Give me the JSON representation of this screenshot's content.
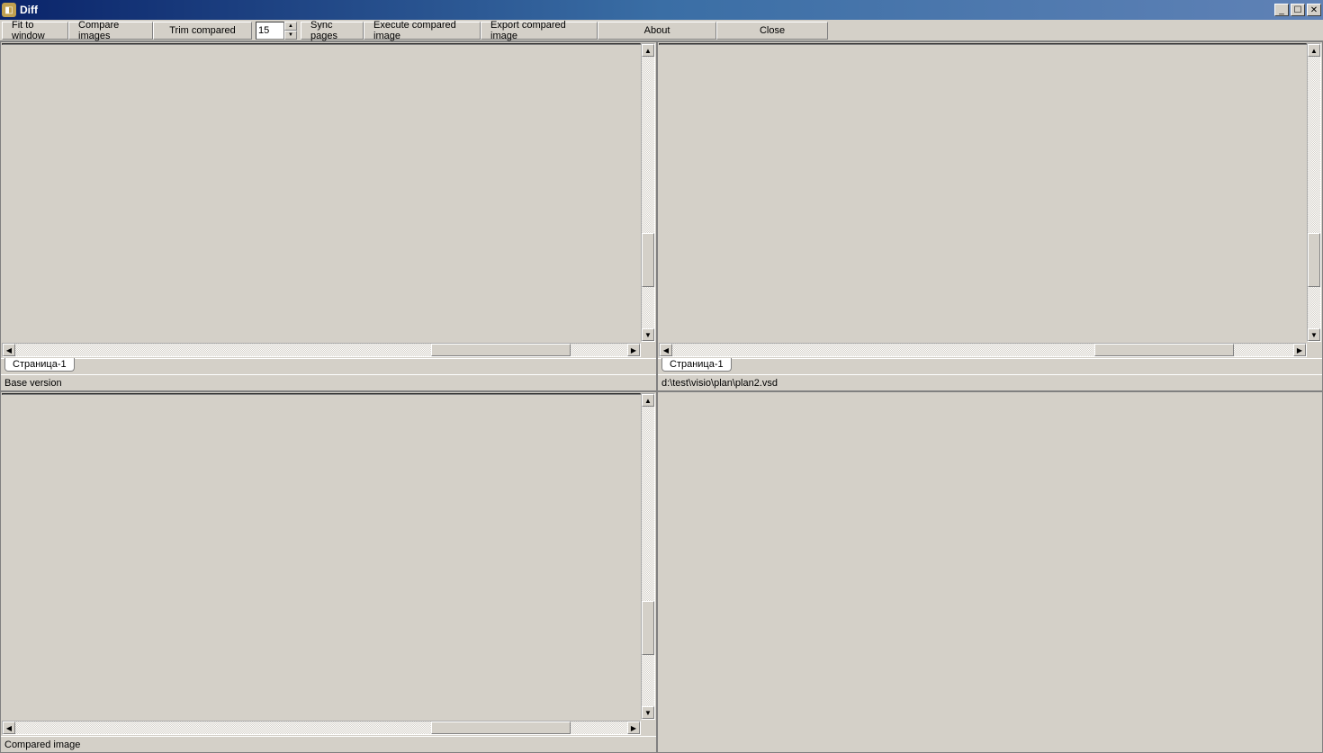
{
  "window": {
    "title": "Diff"
  },
  "toolbar": {
    "fit_label": "Fit to window",
    "compare_label": "Compare images",
    "trim_label": "Trim compared",
    "spinner_value": "15",
    "sync_label": "Sync pages",
    "execute_label": "Execute compared image",
    "export_label": "Export compared image",
    "about_label": "About",
    "close_label": "Close"
  },
  "panes": {
    "top_left": {
      "tab": "Страница-1",
      "status": "Base version"
    },
    "top_right": {
      "tab": "Страница-1",
      "status": "d:\\test\\visio\\plan\\plan2.vsd"
    },
    "bottom_left": {
      "status": "Compared image"
    }
  }
}
